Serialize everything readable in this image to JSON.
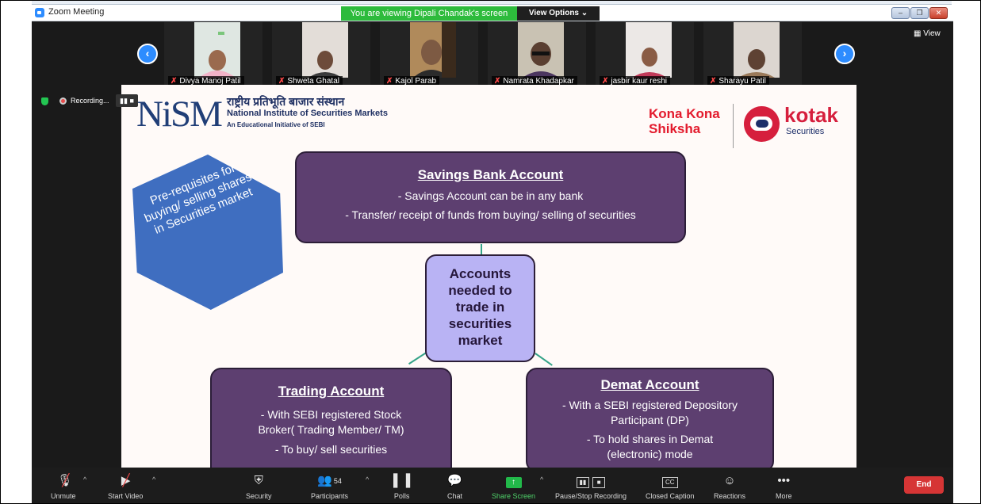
{
  "window": {
    "title": "Zoom Meeting",
    "share_banner": "You are viewing Dipali Chandak's screen",
    "view_options": "View Options",
    "view_button": "View"
  },
  "recording": {
    "label": "Recording..."
  },
  "participants_strip": [
    {
      "name": "Divya Manoj Patil"
    },
    {
      "name": "Shweta Ghatal"
    },
    {
      "name": "Kajol Parab"
    },
    {
      "name": "Namrata Khadapkar"
    },
    {
      "name": "jasbir kaur reshi"
    },
    {
      "name": "Sharayu Patil"
    }
  ],
  "slide": {
    "logo_left": {
      "mark": "NiSM",
      "hindi": "राष्ट्रीय प्रतिभूति बाजार संस्थान",
      "english": "National Institute of Securities Markets",
      "subtitle": "An Educational Initiative of SEBI"
    },
    "logo_right": {
      "kona_line1": "Kona Kona",
      "kona_line2": "Shiksha",
      "brand": "kotak",
      "brand_sub": "Securities"
    },
    "hexagon_text": "Pre-requisites for buying/ selling shares in Securities market",
    "savings": {
      "title": "Savings Bank Account",
      "lines": [
        "- Savings Account can be in any bank",
        "- Transfer/ receipt of funds from buying/ selling of securities"
      ]
    },
    "center": {
      "lines": [
        "Accounts",
        "needed to",
        "trade in",
        "securities",
        "market"
      ]
    },
    "trading": {
      "title": "Trading Account",
      "lines": [
        "- With SEBI registered Stock",
        "Broker( Trading Member/ TM)",
        "- To buy/ sell securities"
      ]
    },
    "demat": {
      "title": "Demat Account",
      "lines": [
        "- With a SEBI registered Depository",
        "Participant (DP)",
        "- To hold shares in Demat",
        "(electronic) mode"
      ]
    }
  },
  "toolbar": {
    "unmute": "Unmute",
    "start_video": "Start Video",
    "security": "Security",
    "participants": "Participants",
    "participants_count": "54",
    "polls": "Polls",
    "chat": "Chat",
    "share_screen": "Share Screen",
    "pause_recording": "Pause/Stop Recording",
    "closed_caption": "Closed Caption",
    "reactions": "Reactions",
    "more": "More",
    "end": "End"
  },
  "colors": {
    "zoom_blue": "#2d8cff",
    "share_green": "#2dbb3c",
    "account_box": "#5d3f70",
    "center_box": "#b9b3f4",
    "hexagon": "#3f6ec0",
    "end_red": "#d63535"
  }
}
